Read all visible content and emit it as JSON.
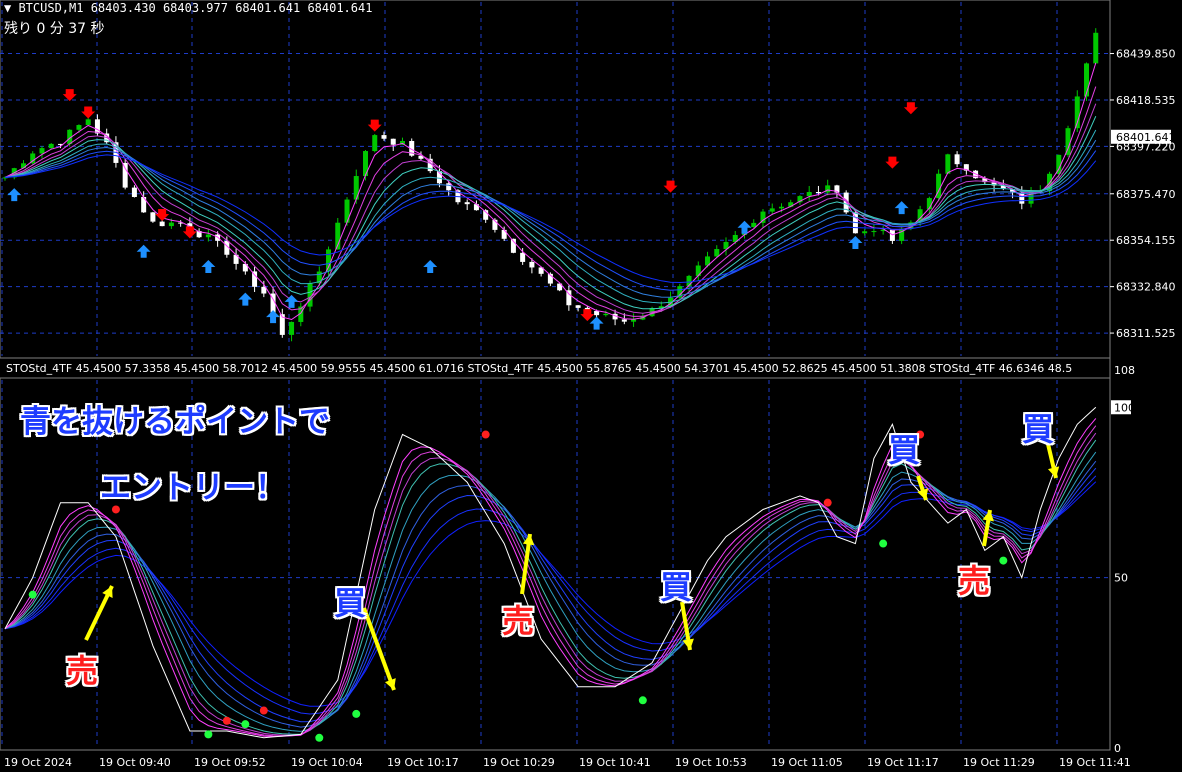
{
  "header": {
    "symbol_line": "BTCUSD,M1  68403.430 68403.977 68401.641 68401.641",
    "timer": "残り 0 分 37 秒",
    "indicator_line": "STOStd_4TF 45.4500 57.3358 45.4500 58.7012 45.4500 59.9555 45.4500 61.0716  STOStd_4TF 45.4500 55.8765 45.4500 54.3701 45.4500 52.8625 45.4500 51.3808  STOStd_4TF 46.6346 48.5"
  },
  "price_axis": {
    "labels": [
      "68439.850",
      "68418.535",
      "68397.220",
      "68375.470",
      "68354.155",
      "68332.840",
      "68311.525"
    ],
    "current": "68401.641"
  },
  "indicator_axis": {
    "labels": [
      "108",
      "100",
      "50",
      "0"
    ]
  },
  "time_axis": [
    "19 Oct 2024",
    "19 Oct 09:40",
    "19 Oct 09:52",
    "19 Oct 10:04",
    "19 Oct 10:17",
    "19 Oct 10:29",
    "19 Oct 10:41",
    "19 Oct 10:53",
    "19 Oct 11:05",
    "19 Oct 11:17",
    "19 Oct 11:29",
    "19 Oct 11:41"
  ],
  "annotations": {
    "line1": "青を抜けるポイントで",
    "line2": "エントリー！",
    "sell_label": "売",
    "buy_label": "買"
  },
  "colors": {
    "bull": "#00c800",
    "bear": "#ffffff",
    "grid": "#1e3cc8",
    "sell_arrow": "#ff0000",
    "buy_arrow": "#1e90ff",
    "yellow": "#ffff00"
  },
  "chart_data": [
    {
      "type": "candlestick",
      "title": "BTCUSD,M1",
      "ylim": [
        68301,
        68458
      ],
      "y_ticks": [
        68439.85,
        68418.535,
        68397.22,
        68375.47,
        68354.155,
        68332.84,
        68311.525
      ],
      "close_path": [
        [
          0,
          68383
        ],
        [
          3,
          68395
        ],
        [
          6,
          68400
        ],
        [
          9,
          68410
        ],
        [
          11,
          68398
        ],
        [
          13,
          68380
        ],
        [
          16,
          68362
        ],
        [
          19,
          68362
        ],
        [
          22,
          68355
        ],
        [
          24,
          68349
        ],
        [
          26,
          68338
        ],
        [
          28,
          68330
        ],
        [
          30,
          68310
        ],
        [
          32,
          68325
        ],
        [
          34,
          68340
        ],
        [
          36,
          68362
        ],
        [
          38,
          68385
        ],
        [
          40,
          68403
        ],
        [
          43,
          68398
        ],
        [
          46,
          68386
        ],
        [
          49,
          68372
        ],
        [
          52,
          68365
        ],
        [
          55,
          68350
        ],
        [
          58,
          68338
        ],
        [
          61,
          68325
        ],
        [
          64,
          68320
        ],
        [
          67,
          68317
        ],
        [
          70,
          68322
        ],
        [
          73,
          68332
        ],
        [
          76,
          68345
        ],
        [
          79,
          68356
        ],
        [
          82,
          68368
        ],
        [
          85,
          68372
        ],
        [
          88,
          68377
        ],
        [
          90,
          68378
        ],
        [
          92,
          68357
        ],
        [
          94,
          68360
        ],
        [
          96,
          68354
        ],
        [
          98,
          68362
        ],
        [
          100,
          68375
        ],
        [
          102,
          68392
        ],
        [
          104,
          68388
        ],
        [
          106,
          68380
        ],
        [
          108,
          68377
        ],
        [
          110,
          68372
        ],
        [
          112,
          68378
        ],
        [
          114,
          68395
        ],
        [
          116,
          68420
        ],
        [
          118,
          68448
        ]
      ],
      "sell_arrows": [
        [
          7,
          68418
        ],
        [
          9,
          68410
        ],
        [
          17,
          68363
        ],
        [
          20,
          68355
        ],
        [
          40,
          68404
        ],
        [
          63,
          68317
        ],
        [
          72,
          68376
        ],
        [
          96,
          68387
        ],
        [
          98,
          68412
        ]
      ],
      "buy_arrows": [
        [
          1,
          68379
        ],
        [
          15,
          68353
        ],
        [
          22,
          68346
        ],
        [
          26,
          68331
        ],
        [
          29,
          68323
        ],
        [
          31,
          68330
        ],
        [
          46,
          68346
        ],
        [
          64,
          68320
        ],
        [
          80,
          68364
        ],
        [
          92,
          68357
        ],
        [
          97,
          68373
        ]
      ]
    },
    {
      "type": "line",
      "title": "STOStd_4TF",
      "ylim": [
        0,
        108
      ],
      "y_ticks": [
        100,
        50,
        0
      ],
      "series": [
        {
          "name": "STOStd_4TF",
          "x": [
            0,
            3,
            6,
            9,
            12,
            16,
            20,
            24,
            28,
            32,
            36,
            40,
            43,
            46,
            50,
            54,
            58,
            62,
            66,
            70,
            72,
            74,
            76,
            78,
            80,
            82,
            84,
            86,
            88,
            90,
            92,
            94,
            96,
            98,
            100,
            102,
            104,
            106,
            108,
            110,
            112,
            114,
            116,
            118
          ],
          "values": [
            35,
            50,
            72,
            72,
            62,
            30,
            5,
            5,
            3,
            4,
            20,
            70,
            92,
            88,
            78,
            60,
            32,
            18,
            18,
            25,
            35,
            45,
            55,
            62,
            66,
            70,
            72,
            74,
            72,
            62,
            60,
            85,
            95,
            78,
            72,
            66,
            70,
            58,
            62,
            50,
            70,
            85,
            95,
            100
          ]
        }
      ],
      "dots_red": [
        [
          12,
          70
        ],
        [
          24,
          8
        ],
        [
          28,
          11
        ],
        [
          52,
          92
        ],
        [
          89,
          72
        ],
        [
          99,
          92
        ]
      ],
      "dots_green": [
        [
          3,
          45
        ],
        [
          22,
          4
        ],
        [
          26,
          7
        ],
        [
          34,
          3
        ],
        [
          38,
          10
        ],
        [
          69,
          14
        ],
        [
          95,
          60
        ],
        [
          108,
          55
        ]
      ]
    }
  ]
}
